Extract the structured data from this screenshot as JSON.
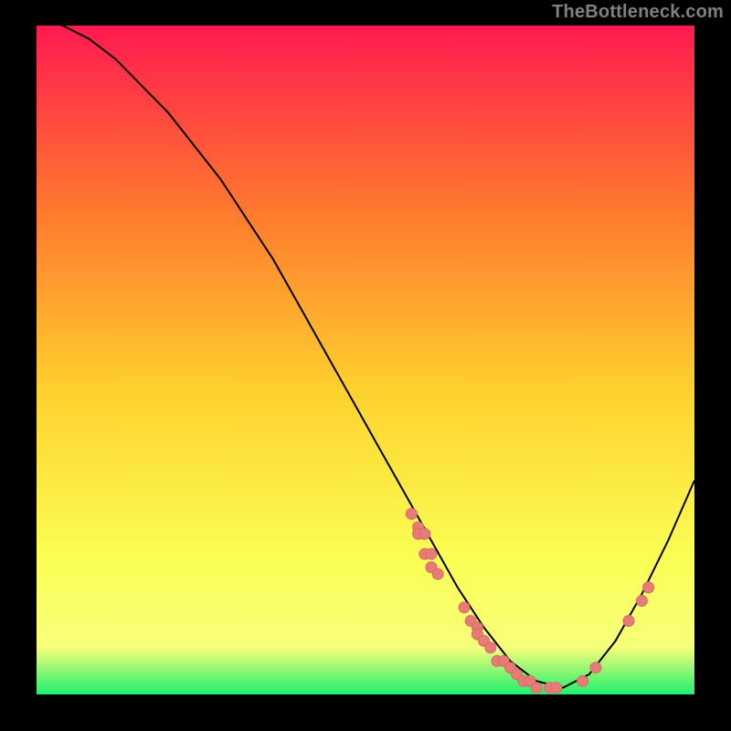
{
  "attribution": "TheBottleneck.com",
  "colors": {
    "bg_black": "#000000",
    "grad_top": "#ff1a4f",
    "grad_mid_upper": "#ff7a2e",
    "grad_mid": "#ffd22e",
    "grad_lower": "#faff55",
    "grad_bottom_yellow": "#f7ff7a",
    "grad_green": "#1ef06e",
    "curve": "#000000",
    "marker_fill": "#e77b77",
    "marker_stroke": "#d96a66"
  },
  "chart_data": {
    "type": "line",
    "title": "",
    "xlabel": "",
    "ylabel": "",
    "xlim": [
      0,
      100
    ],
    "ylim": [
      0,
      100
    ],
    "curve": {
      "name": "bottleneck-curve",
      "x": [
        0,
        4,
        8,
        12,
        16,
        20,
        24,
        28,
        32,
        36,
        40,
        44,
        48,
        52,
        56,
        60,
        64,
        68,
        72,
        76,
        80,
        84,
        88,
        92,
        96,
        100
      ],
      "y": [
        101,
        100,
        98,
        95,
        91,
        87,
        82,
        77,
        71,
        65,
        58,
        51,
        44,
        37,
        30,
        23,
        16,
        10,
        5,
        2,
        1,
        3,
        8,
        15,
        23,
        32
      ]
    },
    "series": [
      {
        "name": "markers",
        "points": [
          {
            "x": 57,
            "y": 27
          },
          {
            "x": 58,
            "y": 25
          },
          {
            "x": 58,
            "y": 24
          },
          {
            "x": 59,
            "y": 24
          },
          {
            "x": 59,
            "y": 21
          },
          {
            "x": 60,
            "y": 21
          },
          {
            "x": 60,
            "y": 19
          },
          {
            "x": 61,
            "y": 18
          },
          {
            "x": 65,
            "y": 13
          },
          {
            "x": 66,
            "y": 11
          },
          {
            "x": 67,
            "y": 10
          },
          {
            "x": 67,
            "y": 9
          },
          {
            "x": 68,
            "y": 8
          },
          {
            "x": 69,
            "y": 7
          },
          {
            "x": 70,
            "y": 5
          },
          {
            "x": 71,
            "y": 5
          },
          {
            "x": 72,
            "y": 4
          },
          {
            "x": 73,
            "y": 3
          },
          {
            "x": 74,
            "y": 2
          },
          {
            "x": 75,
            "y": 2
          },
          {
            "x": 76,
            "y": 1
          },
          {
            "x": 78,
            "y": 1
          },
          {
            "x": 79,
            "y": 1
          },
          {
            "x": 83,
            "y": 2
          },
          {
            "x": 85,
            "y": 4
          },
          {
            "x": 90,
            "y": 11
          },
          {
            "x": 92,
            "y": 14
          },
          {
            "x": 93,
            "y": 16
          }
        ]
      }
    ]
  }
}
